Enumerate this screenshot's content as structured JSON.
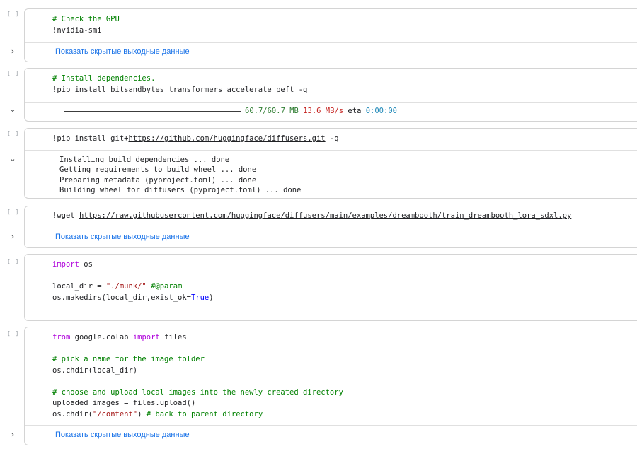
{
  "cells": [
    {
      "exec_label": "[ ]",
      "code": [
        [
          {
            "t": "# Check the GPU",
            "c": "comment"
          }
        ],
        [
          {
            "t": "!nvidia-smi",
            "c": ""
          }
        ]
      ],
      "output": {
        "kind": "hidden",
        "toggle_icon": "chevron-right-icon",
        "toggle": "›",
        "link": "Показать скрытые выходные данные"
      }
    },
    {
      "exec_label": "[ ]",
      "code": [
        [
          {
            "t": "# Install dependencies.",
            "c": "comment"
          }
        ],
        [
          {
            "t": "!pip install bitsandbytes transformers accelerate peft -q",
            "c": ""
          }
        ]
      ],
      "output": {
        "kind": "progress",
        "toggle_icon": "chevron-down-icon",
        "toggle": "⌄",
        "progress": 1.0,
        "size": "60.7/60.7 MB",
        "speed": "13.6 MB/s",
        "eta_label": "eta",
        "eta": "0:00:00"
      }
    },
    {
      "exec_label": "[ ]",
      "code": [
        [
          {
            "t": "!pip install git+",
            "c": ""
          },
          {
            "t": "https://github.com/huggingface/diffusers.git",
            "c": "url"
          },
          {
            "t": " -q",
            "c": ""
          }
        ]
      ],
      "output": {
        "kind": "text",
        "toggle_icon": "chevron-down-icon",
        "toggle": "⌄",
        "lines": [
          "Installing build dependencies ... done",
          "Getting requirements to build wheel ... done",
          "Preparing metadata (pyproject.toml) ... done",
          "Building wheel for diffusers (pyproject.toml) ... done"
        ]
      }
    },
    {
      "exec_label": "[ ]",
      "code": [
        [
          {
            "t": "!wget ",
            "c": ""
          },
          {
            "t": "https://raw.githubusercontent.com/huggingface/diffusers/main/examples/dreambooth/train_dreambooth_lora_sdxl.py",
            "c": "url"
          }
        ]
      ],
      "output": {
        "kind": "hidden",
        "toggle_icon": "chevron-right-icon",
        "toggle": "›",
        "link": "Показать скрытые выходные данные"
      }
    },
    {
      "exec_label": "[ ]",
      "code": [
        [
          {
            "t": "import",
            "c": "keyword"
          },
          {
            "t": " os",
            "c": ""
          }
        ],
        [],
        [
          {
            "t": "local_dir = ",
            "c": ""
          },
          {
            "t": "\"./munk/\"",
            "c": "string"
          },
          {
            "t": " #@param",
            "c": "comment"
          }
        ],
        [
          {
            "t": "os.makedirs(local_dir,exist_ok=",
            "c": ""
          },
          {
            "t": "True",
            "c": "bool"
          },
          {
            "t": ")",
            "c": ""
          }
        ]
      ],
      "output": null
    },
    {
      "exec_label": "[ ]",
      "code": [
        [
          {
            "t": "from",
            "c": "keyword"
          },
          {
            "t": " google.colab ",
            "c": ""
          },
          {
            "t": "import",
            "c": "keyword"
          },
          {
            "t": " files",
            "c": ""
          }
        ],
        [],
        [
          {
            "t": "# pick a name for the image folder",
            "c": "comment"
          }
        ],
        [
          {
            "t": "os.chdir(local_dir)",
            "c": ""
          }
        ],
        [],
        [
          {
            "t": "# choose and upload local images into the newly created directory",
            "c": "comment"
          }
        ],
        [
          {
            "t": "uploaded_images = files.upload()",
            "c": ""
          }
        ],
        [
          {
            "t": "os.chdir(",
            "c": ""
          },
          {
            "t": "\"/content\"",
            "c": "string"
          },
          {
            "t": ") ",
            "c": ""
          },
          {
            "t": "# back to parent directory",
            "c": "comment"
          }
        ]
      ],
      "output": {
        "kind": "hidden",
        "toggle_icon": "chevron-right-icon",
        "toggle": "›",
        "link": "Показать скрытые выходные данные"
      }
    }
  ]
}
